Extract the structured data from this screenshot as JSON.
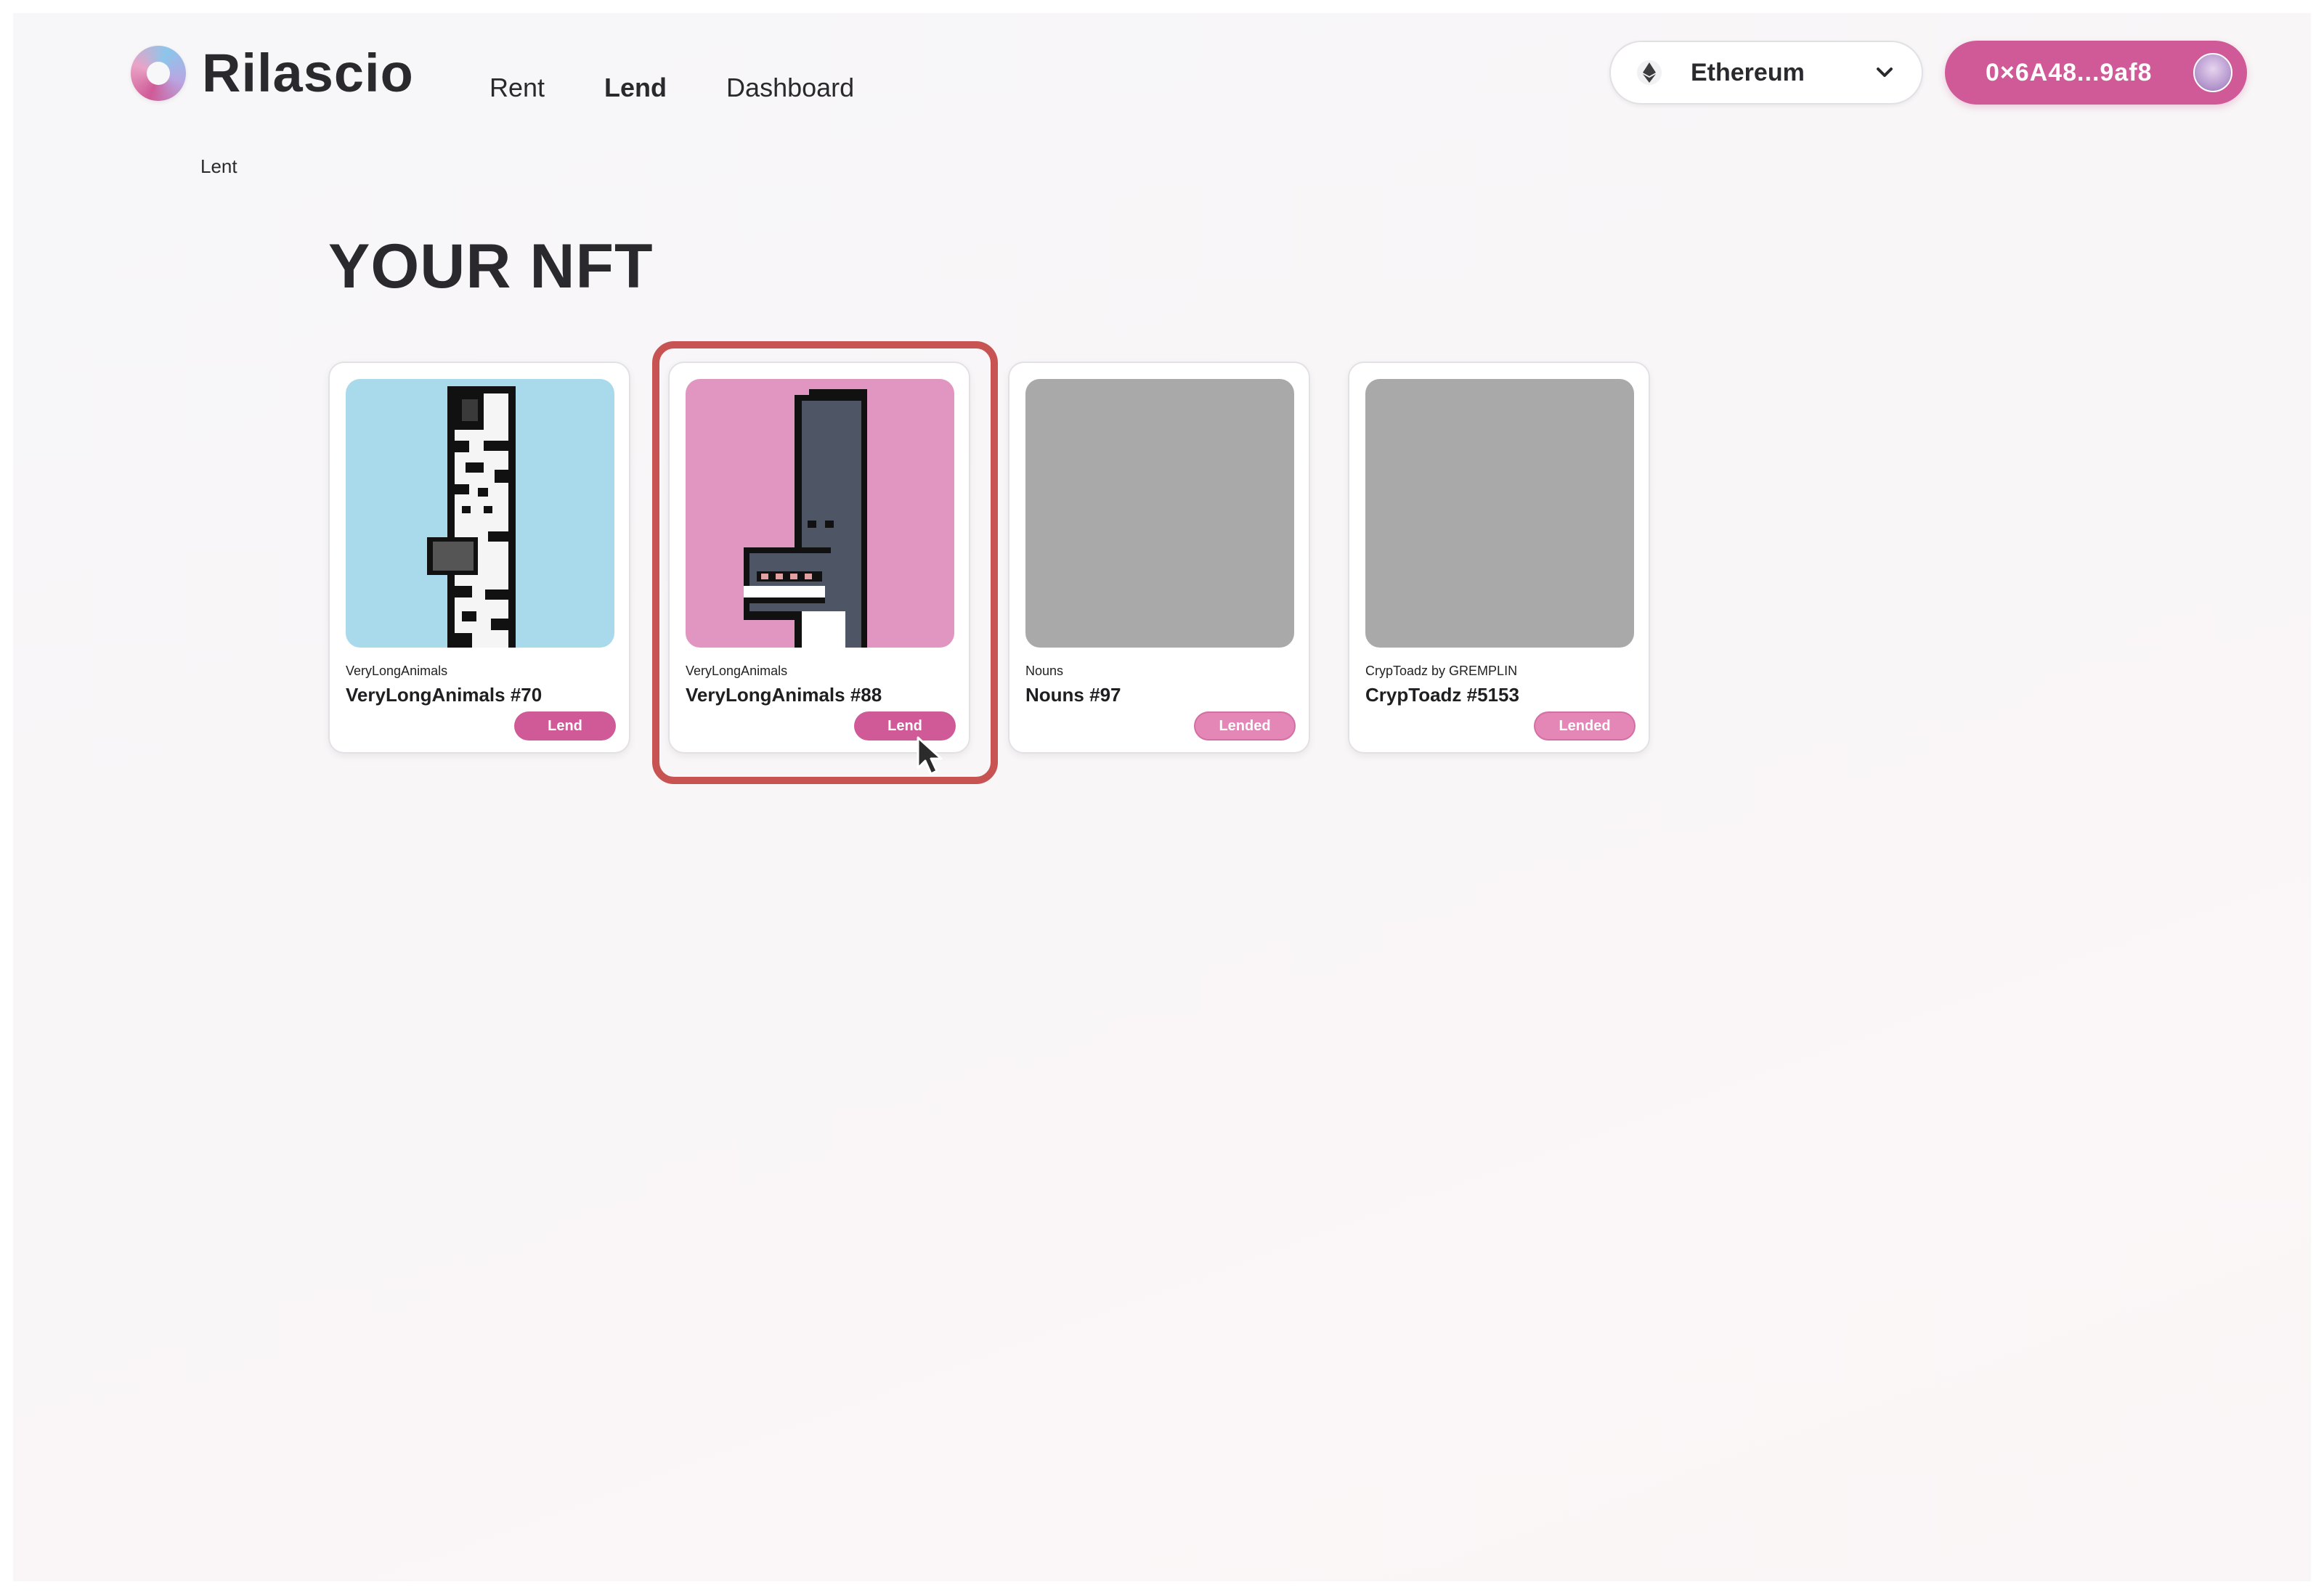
{
  "app": {
    "name": "Rilascio"
  },
  "nav": {
    "items": [
      {
        "label": "Rent",
        "active": false
      },
      {
        "label": "Lend",
        "active": true
      },
      {
        "label": "Dashboard",
        "active": false
      }
    ]
  },
  "network": {
    "selected": "Ethereum",
    "icon": "ethereum-icon"
  },
  "wallet": {
    "address": "0×6A48...9af8",
    "icon": "avatar"
  },
  "breadcrumb": "Lent",
  "page_title": "YOUR NFT",
  "nfts": [
    {
      "collection": "VeryLongAnimals",
      "name": "VeryLongAnimals #70",
      "button": "Lend",
      "bg": "#a8daeb"
    },
    {
      "collection": "VeryLongAnimals",
      "name": "VeryLongAnimals #88",
      "button": "Lend",
      "bg": "#e096c0"
    },
    {
      "collection": "Nouns",
      "name": "Nouns #97",
      "button": "Lended",
      "bg": "#a9a9a9"
    },
    {
      "collection": "CrypToadz by GREMPLIN",
      "name": "CrypToadz #5153",
      "button": "Lended",
      "bg": "#a9a9a9"
    }
  ],
  "colors": {
    "accent": "#cf5a97",
    "accent_light": "#e487b7",
    "highlight": "#c75353",
    "text": "#2a2a2e"
  }
}
